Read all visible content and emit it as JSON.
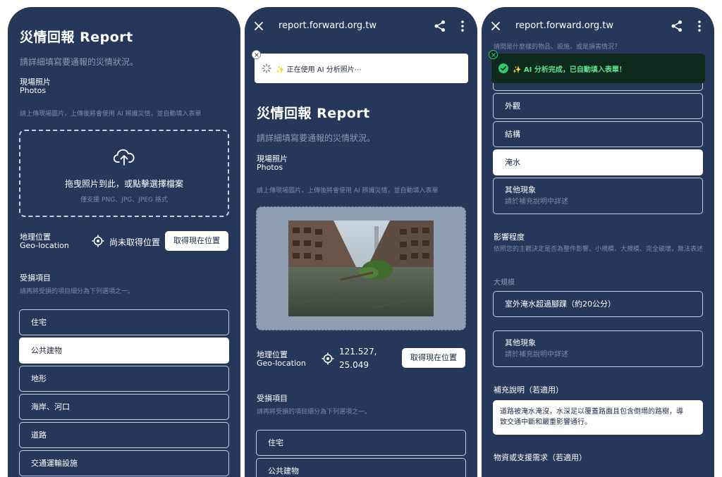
{
  "colors": {
    "phone_bg": "#26385a",
    "success": "#2ecc71",
    "toast_dark": "#0e2a1e"
  },
  "phone1": {
    "title": "災情回報 Report",
    "subtitle": "請詳細填寫要通報的災情狀況。",
    "photos_label_zh": "現場照片",
    "photos_label_en": "Photos",
    "photos_hint": "請上傳現場圖片，上傳後將會使用 AI 辨識災情，並自動填入表單",
    "dropzone_text": "拖曳照片到此，或點擊選擇檔案",
    "dropzone_hint": "僅支援 PNG、JPG、JPEG 格式",
    "geo_label_zh": "地理位置",
    "geo_label_en": "Geo-location",
    "geo_value": "尚未取得位置",
    "geo_button": "取得現在位置",
    "damage_label": "受損項目",
    "damage_hint": "請再將受損的項目細分為下列選項之一。",
    "options": [
      "住宅",
      "公共建物",
      "地形",
      "海岸、河口",
      "道路",
      "交通運輸設施"
    ],
    "selected_option": "公共建物"
  },
  "phone2": {
    "url": "report.forward.org.tw",
    "toast": "✨ 正在使用 AI 分析照片⋯",
    "title": "災情回報 Report",
    "subtitle": "請詳細填寫要通報的災情狀況。",
    "photos_label_zh": "現場照片",
    "photos_label_en": "Photos",
    "photos_hint": "請上傳現場圖片，上傳後將會使用 AI 辨識災情，並自動填入表單",
    "geo_label_zh": "地理位置",
    "geo_label_en": "Geo-location",
    "geo_lng": "121.527,",
    "geo_lat": "25.049",
    "geo_button": "取得現在位置",
    "damage_label": "受損項目",
    "damage_hint": "請再將受損的項目細分為下列選項之一。",
    "options": [
      "住宅",
      "公共建物"
    ]
  },
  "phone3": {
    "url": "report.forward.org.tw",
    "question_hint": "請問是什麼樣的物品、設施、或是損害情況？",
    "toast": "✨ AI 分析完成，已自動填入表單！",
    "options": [
      "外觀",
      "結構",
      "淹水"
    ],
    "selected_option": "淹水",
    "other_label": "其他現象",
    "other_hint": "請於補充說明中詳述",
    "severity_label": "影響程度",
    "severity_hint": "依照您的主觀決定是否為整件影響、小規模、大規模、完全破壞，無法表述",
    "severity_value_label": "大規模",
    "severity_option": "室外淹水超過腳踝（約20公分）",
    "other2_label": "其他現象",
    "other2_hint": "請於補充說明中詳述",
    "notes_label": "補充說明（若適用）",
    "notes_line1": "道路被淹水淹沒，水深足以覆蓋路面且包含倒塌的路樹，導",
    "notes_line2": "致交通中斷和嚴重影響通行。",
    "supplies_label": "物資或支援需求（若適用）"
  }
}
